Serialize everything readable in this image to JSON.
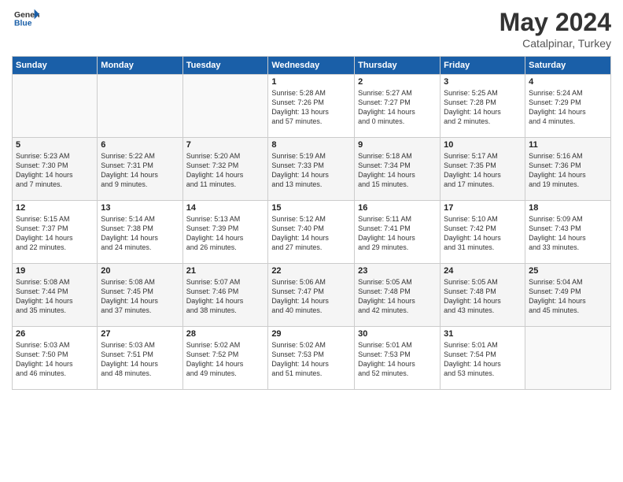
{
  "header": {
    "logo_general": "General",
    "logo_blue": "Blue",
    "title": "May 2024",
    "location": "Catalpinar, Turkey"
  },
  "weekdays": [
    "Sunday",
    "Monday",
    "Tuesday",
    "Wednesday",
    "Thursday",
    "Friday",
    "Saturday"
  ],
  "weeks": [
    [
      {
        "day": "",
        "info": ""
      },
      {
        "day": "",
        "info": ""
      },
      {
        "day": "",
        "info": ""
      },
      {
        "day": "1",
        "info": "Sunrise: 5:28 AM\nSunset: 7:26 PM\nDaylight: 13 hours\nand 57 minutes."
      },
      {
        "day": "2",
        "info": "Sunrise: 5:27 AM\nSunset: 7:27 PM\nDaylight: 14 hours\nand 0 minutes."
      },
      {
        "day": "3",
        "info": "Sunrise: 5:25 AM\nSunset: 7:28 PM\nDaylight: 14 hours\nand 2 minutes."
      },
      {
        "day": "4",
        "info": "Sunrise: 5:24 AM\nSunset: 7:29 PM\nDaylight: 14 hours\nand 4 minutes."
      }
    ],
    [
      {
        "day": "5",
        "info": "Sunrise: 5:23 AM\nSunset: 7:30 PM\nDaylight: 14 hours\nand 7 minutes."
      },
      {
        "day": "6",
        "info": "Sunrise: 5:22 AM\nSunset: 7:31 PM\nDaylight: 14 hours\nand 9 minutes."
      },
      {
        "day": "7",
        "info": "Sunrise: 5:20 AM\nSunset: 7:32 PM\nDaylight: 14 hours\nand 11 minutes."
      },
      {
        "day": "8",
        "info": "Sunrise: 5:19 AM\nSunset: 7:33 PM\nDaylight: 14 hours\nand 13 minutes."
      },
      {
        "day": "9",
        "info": "Sunrise: 5:18 AM\nSunset: 7:34 PM\nDaylight: 14 hours\nand 15 minutes."
      },
      {
        "day": "10",
        "info": "Sunrise: 5:17 AM\nSunset: 7:35 PM\nDaylight: 14 hours\nand 17 minutes."
      },
      {
        "day": "11",
        "info": "Sunrise: 5:16 AM\nSunset: 7:36 PM\nDaylight: 14 hours\nand 19 minutes."
      }
    ],
    [
      {
        "day": "12",
        "info": "Sunrise: 5:15 AM\nSunset: 7:37 PM\nDaylight: 14 hours\nand 22 minutes."
      },
      {
        "day": "13",
        "info": "Sunrise: 5:14 AM\nSunset: 7:38 PM\nDaylight: 14 hours\nand 24 minutes."
      },
      {
        "day": "14",
        "info": "Sunrise: 5:13 AM\nSunset: 7:39 PM\nDaylight: 14 hours\nand 26 minutes."
      },
      {
        "day": "15",
        "info": "Sunrise: 5:12 AM\nSunset: 7:40 PM\nDaylight: 14 hours\nand 27 minutes."
      },
      {
        "day": "16",
        "info": "Sunrise: 5:11 AM\nSunset: 7:41 PM\nDaylight: 14 hours\nand 29 minutes."
      },
      {
        "day": "17",
        "info": "Sunrise: 5:10 AM\nSunset: 7:42 PM\nDaylight: 14 hours\nand 31 minutes."
      },
      {
        "day": "18",
        "info": "Sunrise: 5:09 AM\nSunset: 7:43 PM\nDaylight: 14 hours\nand 33 minutes."
      }
    ],
    [
      {
        "day": "19",
        "info": "Sunrise: 5:08 AM\nSunset: 7:44 PM\nDaylight: 14 hours\nand 35 minutes."
      },
      {
        "day": "20",
        "info": "Sunrise: 5:08 AM\nSunset: 7:45 PM\nDaylight: 14 hours\nand 37 minutes."
      },
      {
        "day": "21",
        "info": "Sunrise: 5:07 AM\nSunset: 7:46 PM\nDaylight: 14 hours\nand 38 minutes."
      },
      {
        "day": "22",
        "info": "Sunrise: 5:06 AM\nSunset: 7:47 PM\nDaylight: 14 hours\nand 40 minutes."
      },
      {
        "day": "23",
        "info": "Sunrise: 5:05 AM\nSunset: 7:48 PM\nDaylight: 14 hours\nand 42 minutes."
      },
      {
        "day": "24",
        "info": "Sunrise: 5:05 AM\nSunset: 7:48 PM\nDaylight: 14 hours\nand 43 minutes."
      },
      {
        "day": "25",
        "info": "Sunrise: 5:04 AM\nSunset: 7:49 PM\nDaylight: 14 hours\nand 45 minutes."
      }
    ],
    [
      {
        "day": "26",
        "info": "Sunrise: 5:03 AM\nSunset: 7:50 PM\nDaylight: 14 hours\nand 46 minutes."
      },
      {
        "day": "27",
        "info": "Sunrise: 5:03 AM\nSunset: 7:51 PM\nDaylight: 14 hours\nand 48 minutes."
      },
      {
        "day": "28",
        "info": "Sunrise: 5:02 AM\nSunset: 7:52 PM\nDaylight: 14 hours\nand 49 minutes."
      },
      {
        "day": "29",
        "info": "Sunrise: 5:02 AM\nSunset: 7:53 PM\nDaylight: 14 hours\nand 51 minutes."
      },
      {
        "day": "30",
        "info": "Sunrise: 5:01 AM\nSunset: 7:53 PM\nDaylight: 14 hours\nand 52 minutes."
      },
      {
        "day": "31",
        "info": "Sunrise: 5:01 AM\nSunset: 7:54 PM\nDaylight: 14 hours\nand 53 minutes."
      },
      {
        "day": "",
        "info": ""
      }
    ]
  ]
}
